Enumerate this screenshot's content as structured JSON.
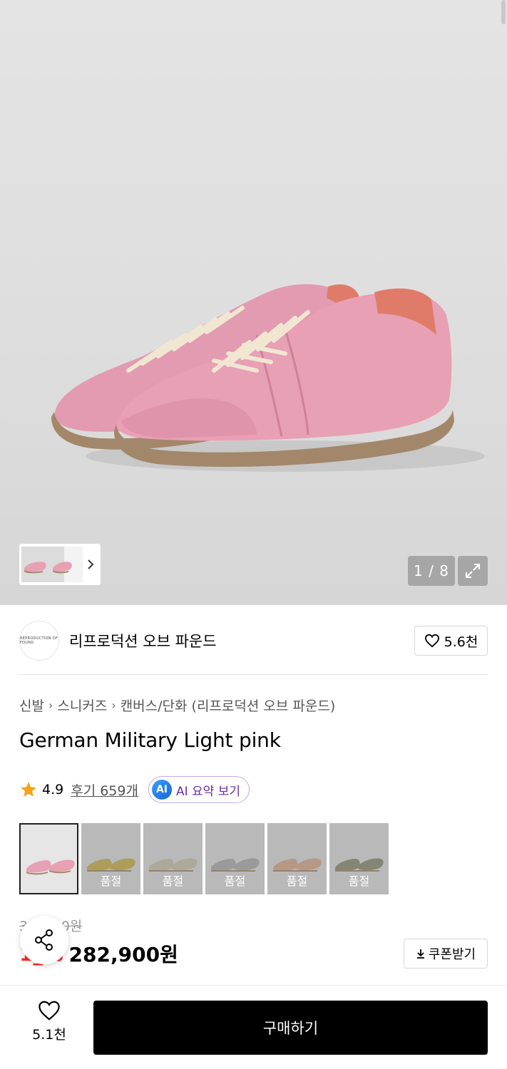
{
  "gallery": {
    "counter": "1 / 8"
  },
  "brand": {
    "logo_text": "REPRODUCTION OF FOUND",
    "name": "리프로덕션 오브 파운드",
    "like_count": "5.6천"
  },
  "breadcrumb": [
    "신발",
    "스니커즈",
    "캔버스/단화 (리프로덕션 오브 파운드)"
  ],
  "product": {
    "title": "German Military Light pink",
    "rating": "4.9",
    "reviews": "후기 659개",
    "ai_badge": "AI",
    "ai_summary": "AI 요약 보기"
  },
  "colors": [
    {
      "name": "light-pink",
      "color": "#e8a0b4",
      "sold_out": false
    },
    {
      "name": "yellow",
      "color": "#c9b14a",
      "sold_out": true,
      "label": "품절"
    },
    {
      "name": "beige",
      "color": "#c8c4ae",
      "sold_out": true,
      "label": "품절"
    },
    {
      "name": "grey",
      "color": "#a9acae",
      "sold_out": true,
      "label": "품절"
    },
    {
      "name": "peach",
      "color": "#d9a98f",
      "sold_out": true,
      "label": "품절"
    },
    {
      "name": "olive",
      "color": "#8a8d72",
      "sold_out": true,
      "label": "품절"
    }
  ],
  "pricing": {
    "original": "3__,_00원",
    "discount": "1_%",
    "price": "282,900원",
    "coupon": "쿠폰받기"
  },
  "bottom": {
    "like_count": "5.1천",
    "buy": "구매하기"
  }
}
